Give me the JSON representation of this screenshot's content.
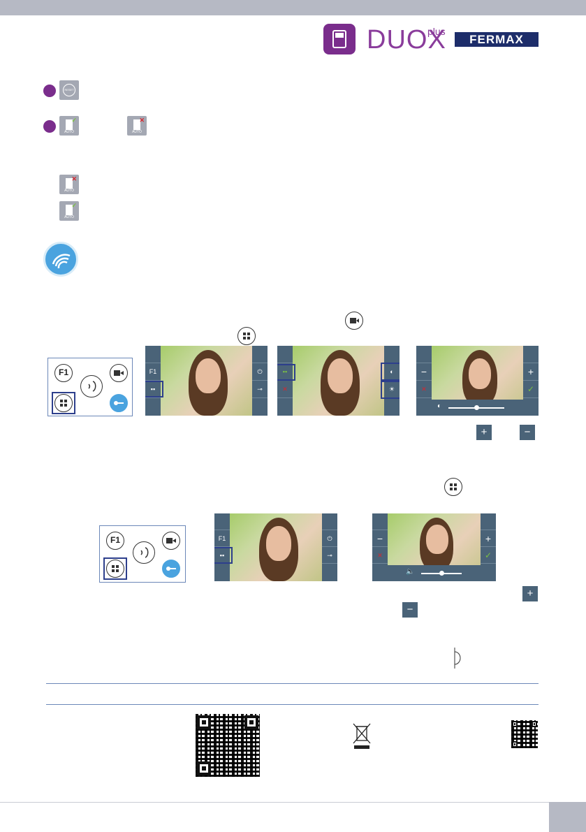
{
  "brand": {
    "product_name": "DUOX",
    "product_suffix": "plus",
    "company": "FERMAX"
  },
  "icons": {
    "reset_label": "RESET",
    "auto_label": "AUTO",
    "f1_label": "F1",
    "plus_sign": "+",
    "minus_sign": "−",
    "check_sign": "✓",
    "cross_sign": "✕"
  },
  "colors": {
    "accent_purple": "#7a2d8c",
    "brand_navy": "#1d2d6a",
    "screen_bar": "#4a6378",
    "key_blue": "#4aa3df"
  },
  "settings": {
    "contrast_level": 0.5,
    "volume_level": 0.5
  }
}
